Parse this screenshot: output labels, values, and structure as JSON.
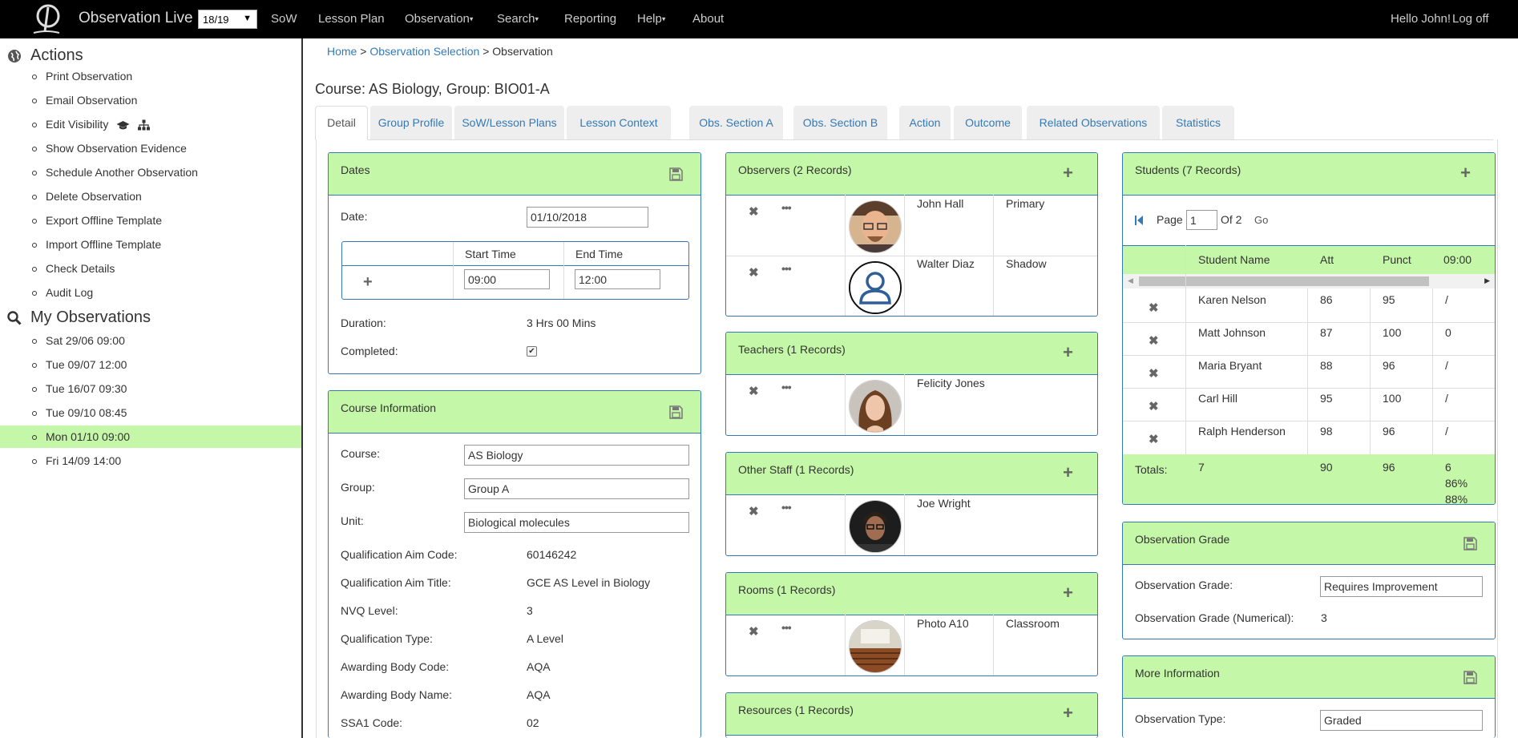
{
  "navbar": {
    "brand": "Observation Live",
    "year_select": "18/19",
    "items": [
      {
        "label": "SoW"
      },
      {
        "label": "Lesson Plan"
      },
      {
        "label": "Observation"
      },
      {
        "label": "Search"
      },
      {
        "label": "Reporting"
      },
      {
        "label": "Help"
      },
      {
        "label": "About"
      }
    ],
    "greeting": "Hello John!",
    "logoff": "Log off"
  },
  "sidebar": {
    "actions_heading": "Actions",
    "actions": [
      "Print Observation",
      "Email Observation",
      "Edit Visibility",
      "Show Observation Evidence",
      "Schedule Another Observation",
      "Delete Observation",
      "Export Offline Template",
      "Import Offline Template",
      "Check Details",
      "Audit Log"
    ],
    "my_obs_heading": "My Observations",
    "observations": [
      "Sat 29/06 09:00",
      "Tue 09/07 12:00",
      "Tue 16/07 09:30",
      "Tue 09/10 08:45",
      "Mon 01/10 09:00",
      "Fri 14/09 14:00"
    ],
    "active_observation": "Mon 01/10 09:00",
    "accent": "#c5f7a8"
  },
  "breadcrumb": {
    "home": "Home",
    "sep": ">",
    "selection": "Observation Selection",
    "current": "Observation"
  },
  "page_title": "Course: AS Biology, Group: BIO01-A",
  "tabs": [
    "Detail",
    "Group Profile",
    "SoW/Lesson Plans",
    "Lesson Context",
    "Obs. Section A",
    "Obs. Section B",
    "Action",
    "Outcome",
    "Related Observations",
    "Statistics"
  ],
  "active_tab": "Detail",
  "dates": {
    "title": "Dates",
    "date_label": "Date:",
    "date_value": "01/10/2018",
    "start_header": "Start Time",
    "end_header": "End Time",
    "start_value": "09:00",
    "end_value": "12:00",
    "duration_label": "Duration:",
    "duration_value": "3 Hrs 00 Mins",
    "completed_label": "Completed:",
    "completed_checked": true
  },
  "course_info": {
    "title": "Course Information",
    "course_label": "Course:",
    "course_value": "AS Biology",
    "group_label": "Group:",
    "group_value": "Group A",
    "unit_label": "Unit:",
    "unit_value": "Biological molecules",
    "rows": [
      {
        "label": "Qualification Aim Code:",
        "value": "60146242"
      },
      {
        "label": "Qualification Aim Title:",
        "value": "GCE AS Level in Biology"
      },
      {
        "label": "NVQ Level:",
        "value": "3"
      },
      {
        "label": "Qualification Type:",
        "value": "A Level"
      },
      {
        "label": "Awarding Body Code:",
        "value": "AQA"
      },
      {
        "label": "Awarding Body Name:",
        "value": "AQA"
      },
      {
        "label": "SSA1 Code:",
        "value": "02"
      }
    ]
  },
  "observers": {
    "title": "Observers (2 Records)",
    "records": [
      {
        "name": "John Hall",
        "role": "Primary",
        "avatar": "photo-man"
      },
      {
        "name": "Walter Diaz",
        "role": "Shadow",
        "avatar": "placeholder-user-icon"
      }
    ]
  },
  "teachers": {
    "title": "Teachers (1 Records)",
    "records": [
      {
        "name": "Felicity Jones",
        "avatar": "photo-woman"
      }
    ]
  },
  "other_staff": {
    "title": "Other Staff (1 Records)",
    "records": [
      {
        "name": "Joe Wright",
        "avatar": "photo-man-dark"
      }
    ]
  },
  "rooms": {
    "title": "Rooms (1 Records)",
    "records": [
      {
        "name": "Photo A10",
        "type": "Classroom",
        "avatar": "photo-classroom"
      }
    ]
  },
  "resources": {
    "title": "Resources (1 Records)"
  },
  "students": {
    "title": "Students (7 Records)",
    "page_label": "Page",
    "page_value": "1",
    "of_label": "Of 2",
    "go_label": "Go",
    "columns": [
      "Student Name",
      "Att",
      "Punct",
      "09:00"
    ],
    "rows": [
      {
        "name": "Karen Nelson",
        "att": "86",
        "punct": "95",
        "t": "/"
      },
      {
        "name": "Matt Johnson",
        "att": "87",
        "punct": "100",
        "t": "0"
      },
      {
        "name": "Maria Bryant",
        "att": "88",
        "punct": "96",
        "t": "/"
      },
      {
        "name": "Carl Hill",
        "att": "95",
        "punct": "100",
        "t": "/"
      },
      {
        "name": "Ralph Henderson",
        "att": "98",
        "punct": "96",
        "t": "/"
      }
    ],
    "totals": {
      "label": "Totals:",
      "count": "7",
      "att": "90",
      "punct": "96",
      "t1": "6",
      "t2": "86%",
      "t3": "88%"
    }
  },
  "grade": {
    "title": "Observation Grade",
    "grade_label": "Observation Grade:",
    "grade_value": "Requires Improvement",
    "numerical_label": "Observation Grade (Numerical):",
    "numerical_value": "3"
  },
  "more_info": {
    "title": "More Information",
    "type_label": "Observation Type:",
    "type_value": "Graded"
  }
}
